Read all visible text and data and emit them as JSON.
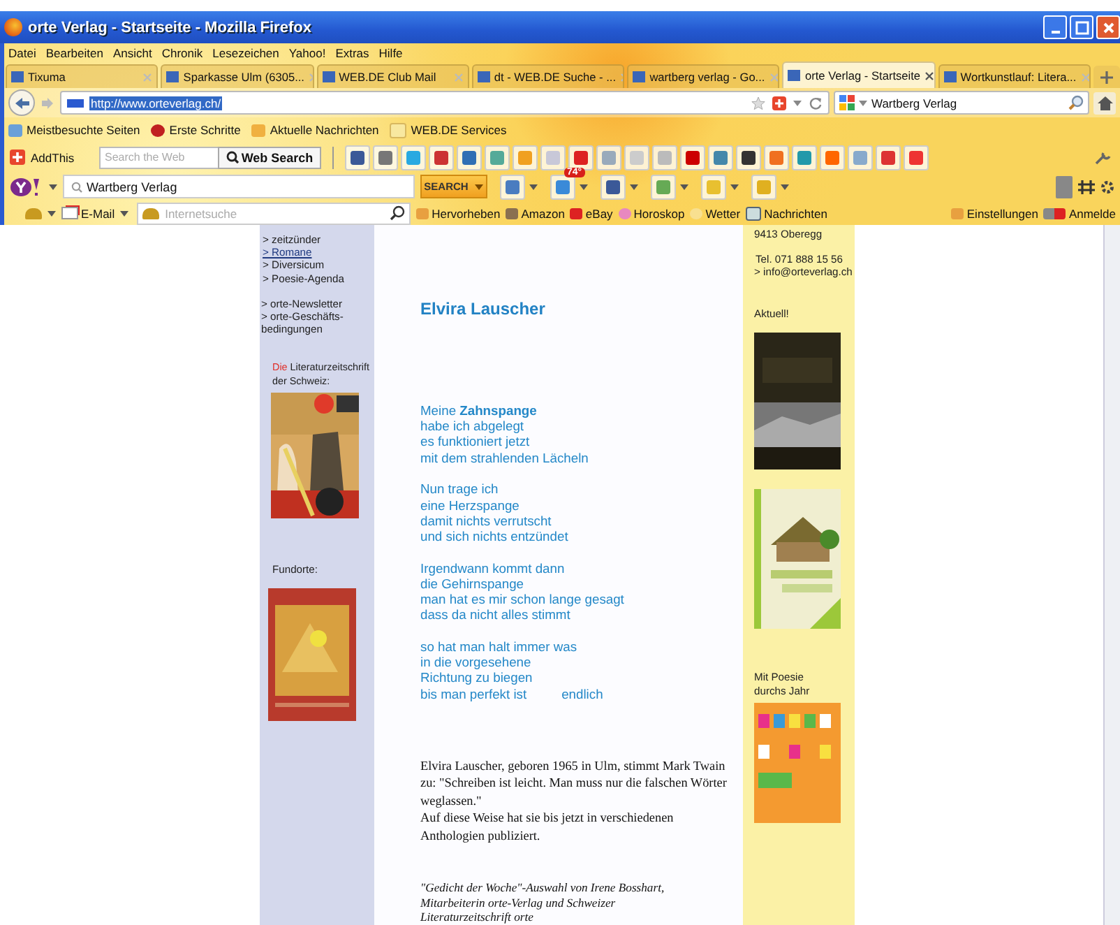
{
  "window": {
    "title": "orte Verlag - Startseite - Mozilla Firefox"
  },
  "menu": [
    "Datei",
    "Bearbeiten",
    "Ansicht",
    "Chronik",
    "Lesezeichen",
    "Yahoo!",
    "Extras",
    "Hilfe"
  ],
  "tabs": [
    {
      "label": "Tixuma",
      "selected": false
    },
    {
      "label": "Sparkasse Ulm (6305...",
      "selected": false
    },
    {
      "label": "WEB.DE Club Mail",
      "selected": false
    },
    {
      "label": "dt - WEB.DE Suche - ...",
      "selected": false
    },
    {
      "label": "wartberg verlag - Go...",
      "selected": false
    },
    {
      "label": "orte Verlag - Startseite",
      "selected": true
    },
    {
      "label": "Wortkunstlauf: Litera...",
      "selected": false
    }
  ],
  "address": {
    "value": "http://www.orteverlag.ch/"
  },
  "engine_search": {
    "value": "Wartberg Verlag"
  },
  "bookmarks": [
    "Meistbesuchte Seiten",
    "Erste Schritte",
    "Aktuelle Nachrichten",
    "WEB.DE Services"
  ],
  "addthis": {
    "label": "AddThis",
    "placeholder": "Search the Web",
    "button": "Web Search"
  },
  "yahoo": {
    "search_value": "Wartberg Verlag",
    "button": "SEARCH",
    "weather_badge": "74°"
  },
  "webde": {
    "email": "E-Mail",
    "placeholder": "Internetsuche",
    "items": [
      "Hervorheben",
      "Amazon",
      "eBay",
      "Horoskop",
      "Wetter",
      "Nachrichten"
    ],
    "settings": "Einstellungen",
    "login": "Anmelde"
  },
  "left_nav": {
    "groups": [
      [
        {
          "label": "> zeitzünder",
          "underlined": false
        },
        {
          "label": "> Romane",
          "underlined": true
        },
        {
          "label": "> Diversicum",
          "underlined": false
        },
        {
          "label": "> Poesie-Agenda",
          "underlined": false
        }
      ],
      [
        {
          "label": "> orte-Newsletter",
          "underlined": false
        },
        {
          "label": "> orte-Geschäfts-bedingungen",
          "underlined": false
        }
      ]
    ],
    "magazine": {
      "highlight": "Die",
      "text": "Literaturzeitschrift der Schweiz:"
    },
    "fundorte": "Fundorte:"
  },
  "article": {
    "title": "Elvira Lauscher",
    "stanzas": [
      [
        "Meine **Zahnspange**",
        "habe ich abgelegt",
        "es funktioniert jetzt",
        "mit dem strahlenden Lächeln"
      ],
      [
        "Nun trage ich",
        "eine Herzspange",
        "damit nichts verrutscht",
        "und sich nichts entzündet"
      ],
      [
        "Irgendwann kommt dann",
        "die Gehirnspange",
        "man hat es mir schon lange gesagt",
        "dass da nicht alles stimmt"
      ],
      [
        "so hat man halt immer was",
        "in die vorgesehene",
        "Richtung zu biegen",
        "bis man perfekt ist"
      ]
    ],
    "last_word": "endlich",
    "bio": [
      "Elvira Lauscher, geboren 1965 in Ulm, stimmt Mark Twain zu: \"Schreiben ist leicht. Man muss nur die falschen Wörter weglassen.\"",
      "Auf diese Weise hat sie bis jetzt in verschiedenen Anthologien publiziert."
    ],
    "credit": "\"Gedicht der Woche\"-Auswahl von Irene Bosshart, Mitarbeiterin orte-Verlag und Schweizer Literaturzeitschrift orte"
  },
  "right": {
    "address": "9413 Oberegg",
    "phone": "Tel. 071 888 15 56",
    "email": "> info@orteverlag.ch",
    "news": "Aktuell!",
    "poesie": "Mit Poesie durchs Jahr"
  }
}
